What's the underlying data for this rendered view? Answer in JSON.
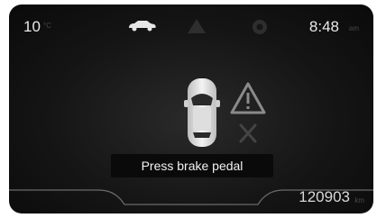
{
  "status_bar": {
    "temperature": "10",
    "temperature_unit": "°C",
    "time": "8:48",
    "time_suffix": "am"
  },
  "icons": {
    "car_top": "car-icon",
    "warning_top": "warning-icon",
    "settings_top": "gear-icon"
  },
  "main": {
    "message": "Press brake pedal"
  },
  "footer": {
    "odometer": "120903",
    "odometer_unit": "km"
  },
  "colors": {
    "background": "#151515",
    "text": "#e9e9e9",
    "dim_icon": "#2e2e2e",
    "warning_outline": "#8a8a8a"
  }
}
